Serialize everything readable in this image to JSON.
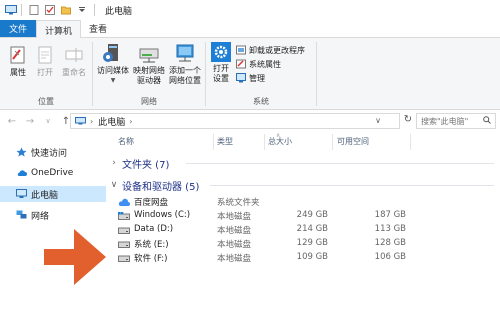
{
  "window": {
    "title": "此电脑"
  },
  "tabs": {
    "file": "文件",
    "computer": "计算机",
    "view": "查看"
  },
  "ribbon": {
    "location": {
      "label": "位置",
      "properties": "属性",
      "open": "打开",
      "rename": "重命名"
    },
    "network": {
      "label": "网络",
      "access_media": "访问媒体",
      "map_drive_1": "映射网络",
      "map_drive_2": "驱动器",
      "add_location_1": "添加一个",
      "add_location_2": "网络位置"
    },
    "system": {
      "label": "系统",
      "open_settings_1": "打开",
      "open_settings_2": "设置",
      "uninstall": "卸载或更改程序",
      "system_properties": "系统属性",
      "manage": "管理"
    }
  },
  "address": {
    "crumb": "此电脑",
    "search_placeholder": "搜索\"此电脑\""
  },
  "nav": {
    "quick_access": "快速访问",
    "onedrive": "OneDrive",
    "this_pc": "此电脑",
    "network": "网络"
  },
  "columns": {
    "name": "名称",
    "type": "类型",
    "total": "总大小",
    "free": "可用空间"
  },
  "sections": {
    "folders": "文件夹 (7)",
    "devices": "设备和驱动器 (5)"
  },
  "drives": [
    {
      "name": "百度网盘",
      "type": "系统文件夹",
      "total": "",
      "free": ""
    },
    {
      "name": "Windows (C:)",
      "type": "本地磁盘",
      "total": "249 GB",
      "free": "187 GB"
    },
    {
      "name": "Data (D:)",
      "type": "本地磁盘",
      "total": "214 GB",
      "free": "113 GB"
    },
    {
      "name": "系统 (E:)",
      "type": "本地磁盘",
      "total": "129 GB",
      "free": "128 GB"
    },
    {
      "name": "软件 (F:)",
      "type": "本地磁盘",
      "total": "109 GB",
      "free": "106 GB"
    }
  ],
  "colors": {
    "accent": "#1979ca",
    "selected": "#cce8ff",
    "section_text": "#1e3287",
    "arrow": "#e2602d"
  }
}
